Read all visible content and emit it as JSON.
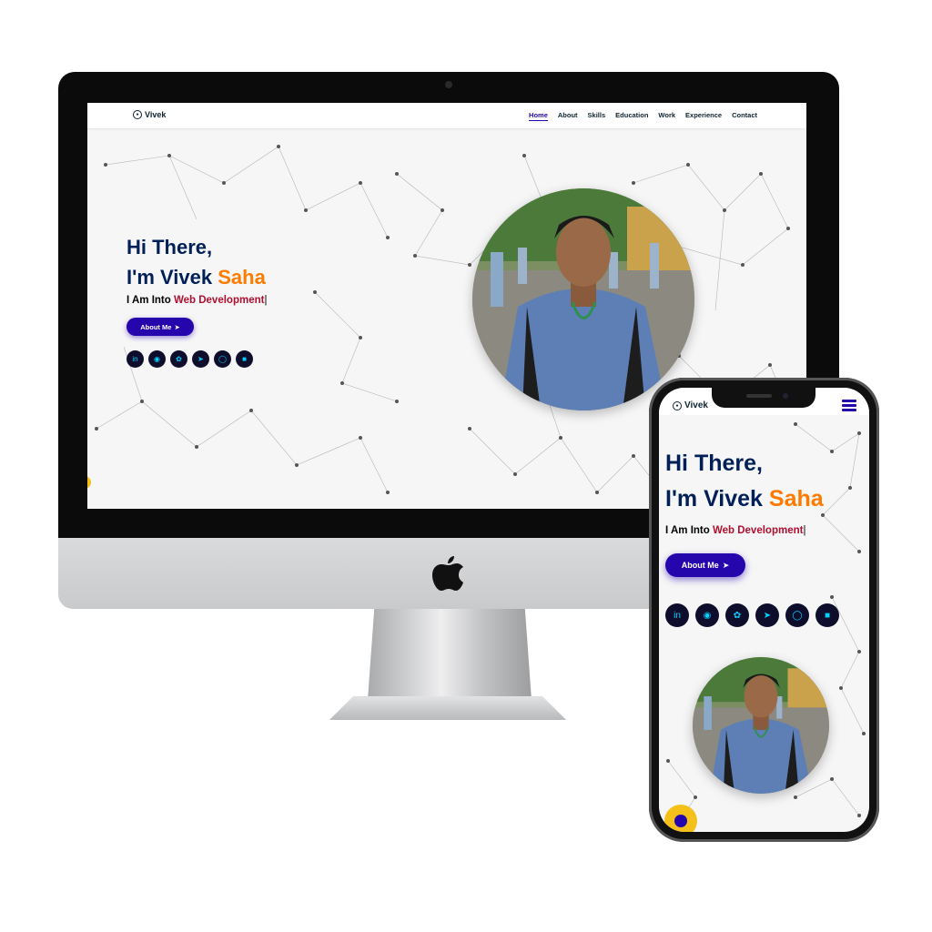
{
  "site": {
    "brand": "Vivek",
    "nav_links": [
      "Home",
      "About",
      "Skills",
      "Education",
      "Work",
      "Experience",
      "Contact"
    ],
    "active_link": "Home"
  },
  "hero": {
    "greeting": "Hi There,",
    "intro_prefix": "I'm Vivek ",
    "intro_highlight": "Saha",
    "subtitle_prefix": "I Am Into ",
    "subtitle_highlight": "Web Development",
    "cursor": "|",
    "about_button": "About Me",
    "social_icons": [
      "linkedin-icon",
      "github-icon",
      "twitter-icon",
      "telegram-icon",
      "instagram-icon",
      "dev-icon"
    ]
  },
  "colors": {
    "primary": "#2506ad",
    "heading": "#002057",
    "accent_orange": "#ff7b00",
    "accent_red": "#b00f2f",
    "social_bg": "#0e0e2c",
    "social_fg": "#00d1ff",
    "chat_button": "#f6c01b"
  }
}
